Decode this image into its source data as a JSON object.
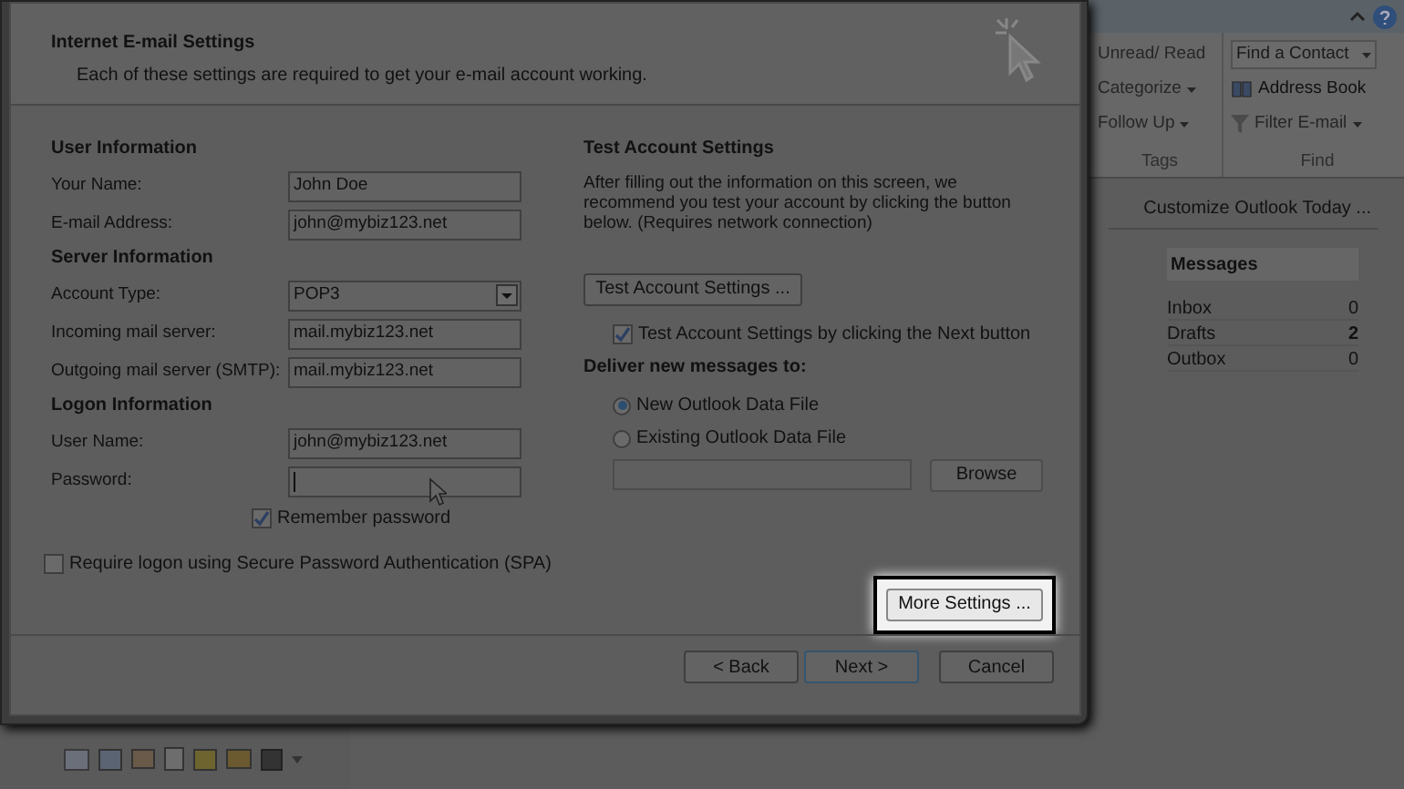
{
  "dialog": {
    "title": "Internet E-mail Settings",
    "subtitle": "Each of these settings are required to get your e-mail account working.",
    "sections": [
      {
        "heading": "User Information",
        "fields": [
          {
            "label": "Your Name:",
            "value": "John Doe",
            "kind": "text"
          },
          {
            "label": "E-mail Address:",
            "value": "john@mybiz123.net",
            "kind": "text"
          }
        ]
      },
      {
        "heading": "Server Information",
        "fields": [
          {
            "label": "Account Type:",
            "value": "POP3",
            "kind": "dropdown"
          },
          {
            "label": "Incoming mail server:",
            "value": "mail.mybiz123.net",
            "kind": "text"
          },
          {
            "label": "Outgoing mail server (SMTP):",
            "value": "mail.mybiz123.net",
            "kind": "text"
          }
        ]
      },
      {
        "heading": "Logon Information",
        "fields": [
          {
            "label": "User Name:",
            "value": "john@mybiz123.net",
            "kind": "text"
          },
          {
            "label": "Password:",
            "kind": "password",
            "focused": true
          }
        ]
      }
    ],
    "remember_password": {
      "label": "Remember password",
      "checked": true
    },
    "spa": {
      "label": "Require logon using Secure Password Authentication (SPA)",
      "checked": false
    },
    "test": {
      "heading": "Test Account Settings",
      "description": "After filling out the information on this screen, we recommend you test your account by clicking the button below. (Requires network connection)",
      "button": "Test Account Settings ...",
      "next_check": {
        "label": "Test Account Settings by clicking the Next button",
        "checked": true
      }
    },
    "deliver": {
      "heading": "Deliver new messages to:",
      "options": [
        {
          "label": "New Outlook Data File",
          "selected": true
        },
        {
          "label": "Existing Outlook Data File",
          "selected": false
        }
      ],
      "browse": {
        "label": "Browse",
        "disabled": true
      }
    },
    "more_settings": {
      "label": "More Settings ...",
      "highlighted": true
    },
    "buttons": [
      {
        "label": "< Back",
        "default": false
      },
      {
        "label": "Next >",
        "default": true
      },
      {
        "label": "Cancel",
        "default": false
      }
    ]
  },
  "ribbon": {
    "groups": [
      {
        "label": "Tags",
        "items": [
          {
            "label": "Unread/ Read",
            "dropdown": false
          },
          {
            "label": "Categorize",
            "dropdown": true
          },
          {
            "label": "Follow Up",
            "dropdown": true
          }
        ]
      },
      {
        "label": "Find",
        "items": [
          {
            "label": "Find a Contact",
            "dropdown": true,
            "kind": "field"
          },
          {
            "label": "Address Book",
            "dropdown": false,
            "kind": "book"
          },
          {
            "label": "Filter E-mail",
            "dropdown": true,
            "kind": "filter"
          }
        ]
      }
    ]
  },
  "outlook_today": {
    "customize": "Customize Outlook Today ...",
    "messages": {
      "heading": "Messages",
      "rows": [
        {
          "label": "Inbox",
          "count": "0",
          "emphasized": false
        },
        {
          "label": "Drafts",
          "count": "2",
          "emphasized": true
        },
        {
          "label": "Outbox",
          "count": "0",
          "emphasized": false
        }
      ]
    }
  }
}
